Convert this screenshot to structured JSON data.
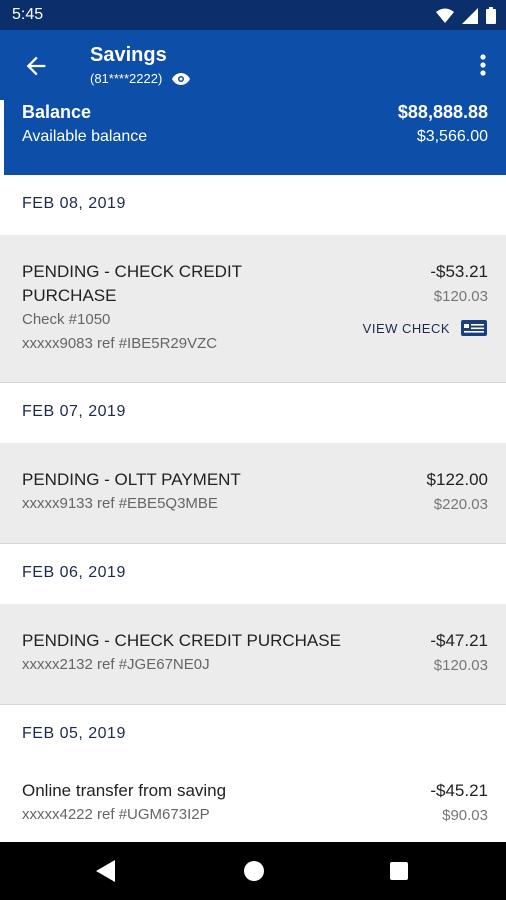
{
  "status_bar": {
    "time": "5:45"
  },
  "header": {
    "title": "Savings",
    "account_masked": "(81****2222)"
  },
  "balance": {
    "label": "Balance",
    "value": "$88,888.88",
    "available_label": "Available balance",
    "available_value": "$3,566.00"
  },
  "groups": [
    {
      "date": "FEB 08, 2019",
      "transactions": [
        {
          "desc_line1": "PENDING - CHECK CREDIT",
          "desc_line2": "PURCHASE",
          "check": "Check #1050",
          "ref": "xxxxx9083 ref #IBE5R29VZC",
          "amount": "-$53.21",
          "balance": "$120.03",
          "action": "VIEW CHECK"
        }
      ]
    },
    {
      "date": "FEB 07, 2019",
      "transactions": [
        {
          "desc": "PENDING - OLTT PAYMENT",
          "ref": "xxxxx9133 ref #EBE5Q3MBE",
          "amount": "$122.00",
          "balance": "$220.03"
        }
      ]
    },
    {
      "date": "FEB 06, 2019",
      "transactions": [
        {
          "desc": "PENDING - CHECK CREDIT PURCHASE",
          "ref": "xxxxx2132 ref #JGE67NE0J",
          "amount": "-$47.21",
          "balance": "$120.03"
        }
      ]
    },
    {
      "date": "FEB 05, 2019",
      "transactions": [
        {
          "desc": "Online transfer from saving",
          "ref": "xxxxx4222 ref #UGM673I2P",
          "amount": "-$45.21",
          "balance": "$90.03"
        }
      ]
    }
  ],
  "colors": {
    "primary": "#0c4ea8",
    "statusbar": "#0b2f6b",
    "card": "#ececec",
    "date_text": "#1c2a4d"
  },
  "icons": [
    "wifi-icon",
    "signal-icon",
    "battery-icon",
    "back-arrow-icon",
    "eye-icon",
    "more-vert-icon",
    "check-image-icon",
    "nav-back-icon",
    "nav-home-icon",
    "nav-recents-icon"
  ]
}
